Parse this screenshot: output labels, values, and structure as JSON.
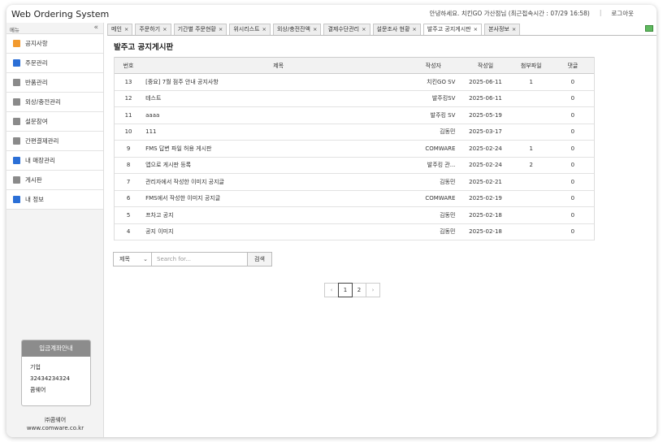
{
  "header": {
    "app_title": "Web Ordering System",
    "greeting": "안녕하세요. 치킨GO 가산점님 (최근접속시간 : 07/29 16:58)",
    "separator": "|",
    "logout_label": "로그아웃"
  },
  "sidebar": {
    "title": "메뉴",
    "collapse_icon": "«",
    "items": [
      {
        "label": "공지사항",
        "color": "#f29a2e"
      },
      {
        "label": "주문관리",
        "color": "#2b6fd6"
      },
      {
        "label": "반품관리",
        "color": "#8a8a8a"
      },
      {
        "label": "외상/충전관리",
        "color": "#8a8a8a"
      },
      {
        "label": "설문참여",
        "color": "#8a8a8a"
      },
      {
        "label": "간편결제관리",
        "color": "#8a8a8a"
      },
      {
        "label": "내 매장관리",
        "color": "#2b6fd6"
      },
      {
        "label": "게시판",
        "color": "#8a8a8a"
      },
      {
        "label": "내 정보",
        "color": "#2b6fd6"
      }
    ],
    "bank": {
      "title": "입금계좌안내",
      "bank_name": "기업",
      "account": "32434234324",
      "holder": "콤웨어"
    },
    "company": "㈜콤웨어",
    "website": "www.comware.co.kr"
  },
  "tabs": [
    {
      "label": "메인",
      "close": "×"
    },
    {
      "label": "주문하기",
      "close": "×"
    },
    {
      "label": "기간별 주문현황",
      "close": "×"
    },
    {
      "label": "위시리스트",
      "close": "×"
    },
    {
      "label": "외상/충전잔액",
      "close": "×"
    },
    {
      "label": "결제수단관리",
      "close": "×"
    },
    {
      "label": "설문조사 현황",
      "close": "×"
    },
    {
      "label": "발주고 공지게시판",
      "close": "×"
    },
    {
      "label": "본사정보",
      "close": "×"
    }
  ],
  "board": {
    "title": "발주고 공지게시판",
    "columns": [
      "번호",
      "제목",
      "작성자",
      "작성일",
      "첨부파일",
      "댓글"
    ],
    "rows": [
      {
        "no": "13",
        "title": "[중요] 7월 점주 안내 공지사항",
        "writer": "치킨GO SV",
        "date": "2025-06-11",
        "files": "1",
        "comments": "0"
      },
      {
        "no": "12",
        "title": "테스트",
        "writer": "발주킹SV",
        "date": "2025-06-11",
        "files": "",
        "comments": "0"
      },
      {
        "no": "11",
        "title": "aaaa",
        "writer": "발주킹 SV",
        "date": "2025-05-19",
        "files": "",
        "comments": "0"
      },
      {
        "no": "10",
        "title": "111",
        "writer": "김동민",
        "date": "2025-03-17",
        "files": "",
        "comments": "0"
      },
      {
        "no": "9",
        "title": "FMS 답변 파일 허용 게시판",
        "writer": "COMWARE",
        "date": "2025-02-24",
        "files": "1",
        "comments": "0"
      },
      {
        "no": "8",
        "title": "앱으로 게시판 등록",
        "writer": "발주킹 관...",
        "date": "2025-02-24",
        "files": "2",
        "comments": "0"
      },
      {
        "no": "7",
        "title": "관리자에서 작성한 이미지 공지글",
        "writer": "김동민",
        "date": "2025-02-21",
        "files": "",
        "comments": "0"
      },
      {
        "no": "6",
        "title": "FMS에서 작성한 이미지 공지글",
        "writer": "COMWARE",
        "date": "2025-02-19",
        "files": "",
        "comments": "0"
      },
      {
        "no": "5",
        "title": "프차고 공지",
        "writer": "김동민",
        "date": "2025-02-18",
        "files": "",
        "comments": "0"
      },
      {
        "no": "4",
        "title": "공지 이미지",
        "writer": "김동민",
        "date": "2025-02-18",
        "files": "",
        "comments": "0"
      }
    ]
  },
  "search": {
    "field_value": "제목",
    "placeholder": "Search for...",
    "button_label": "검색"
  },
  "pagination": {
    "prev": "‹",
    "pages": [
      "1",
      "2"
    ],
    "current": "1",
    "next": "›"
  }
}
